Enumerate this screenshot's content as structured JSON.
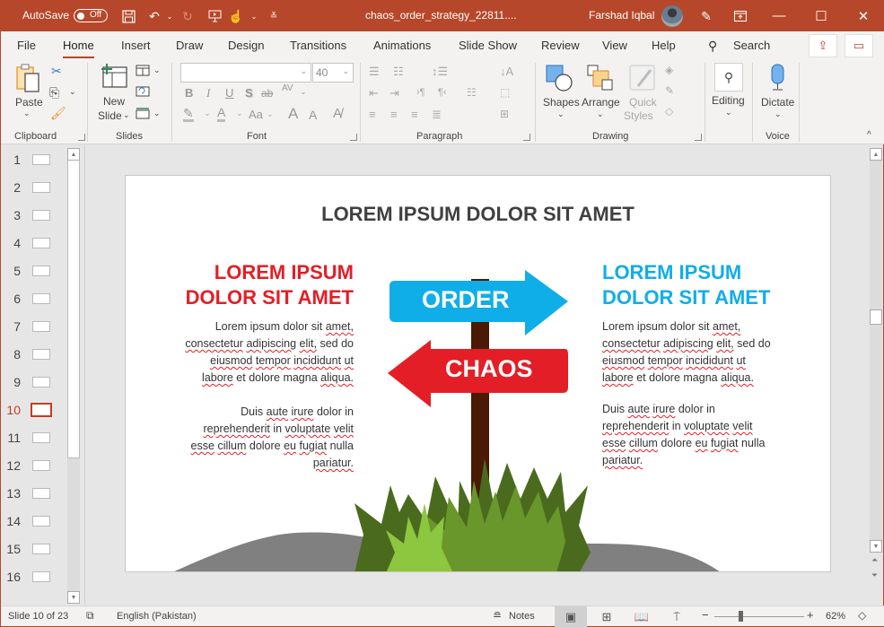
{
  "titlebar": {
    "autosave_label": "AutoSave",
    "autosave_state": "Off",
    "filename": "chaos_order_strategy_22811....",
    "user_name": "Farshad Iqbal"
  },
  "tabs": {
    "items": [
      "File",
      "Home",
      "Insert",
      "Draw",
      "Design",
      "Transitions",
      "Animations",
      "Slide Show",
      "Review",
      "View",
      "Help"
    ],
    "active": "Home",
    "search_label": "Search"
  },
  "ribbon": {
    "clipboard": {
      "label": "Clipboard",
      "paste": "Paste"
    },
    "slides": {
      "label": "Slides",
      "new_slide_1": "New",
      "new_slide_2": "Slide"
    },
    "font": {
      "label": "Font",
      "font_name": "",
      "font_size": "40",
      "bold": "B",
      "italic": "I",
      "underline": "U",
      "shadow": "S",
      "strike": "ab",
      "spacing": "AV",
      "case": "Aa",
      "grow": "A",
      "shrink": "A"
    },
    "paragraph": {
      "label": "Paragraph"
    },
    "drawing": {
      "label": "Drawing",
      "shapes": "Shapes",
      "arrange": "Arrange",
      "quick_1": "Quick",
      "quick_2": "Styles"
    },
    "editing": {
      "label": "Editing"
    },
    "voice": {
      "label": "Voice",
      "dictate": "Dictate"
    }
  },
  "thumbnails": {
    "items": [
      "1",
      "2",
      "3",
      "4",
      "5",
      "6",
      "7",
      "8",
      "9",
      "10",
      "11",
      "12",
      "13",
      "14",
      "15",
      "16"
    ],
    "active": "10"
  },
  "slide": {
    "title": "LOREM IPSUM DOLOR SIT AMET",
    "left": {
      "heading_1": "LOREM IPSUM",
      "heading_2": "DOLOR SIT AMET",
      "para1": [
        "Lorem ipsum dolor sit amet,",
        "consectetur adipiscing elit, sed do",
        "eiusmod tempor incididunt ut",
        "labore et dolore magna aliqua."
      ],
      "para2": [
        "Duis aute irure dolor in",
        "reprehenderit in voluptate velit",
        "esse cillum dolore eu fugiat nulla",
        "pariatur."
      ]
    },
    "right": {
      "heading_1": "LOREM IPSUM",
      "heading_2": "DOLOR SIT AMET",
      "para1": [
        "Lorem ipsum dolor sit amet,",
        "consectetur adipiscing elit, sed do",
        "eiusmod tempor incididunt ut",
        "labore et dolore magna aliqua."
      ],
      "para2": [
        "Duis aute irure dolor in",
        "reprehenderit in voluptate velit",
        "esse cillum dolore eu fugiat nulla",
        "pariatur."
      ]
    },
    "sign_order": "ORDER",
    "sign_chaos": "CHAOS",
    "colors": {
      "red": "#e41e26",
      "blue": "#10aee8",
      "post": "#4a1a06",
      "grass_dark": "#4a6b1e",
      "grass_mid": "#6a972b",
      "grass_light": "#8dc63f",
      "hill": "#808080"
    }
  },
  "status": {
    "slide_info": "Slide 10 of 23",
    "language": "English (Pakistan)",
    "notes": "Notes",
    "zoom": "62%",
    "zoom_level": 0.62
  }
}
